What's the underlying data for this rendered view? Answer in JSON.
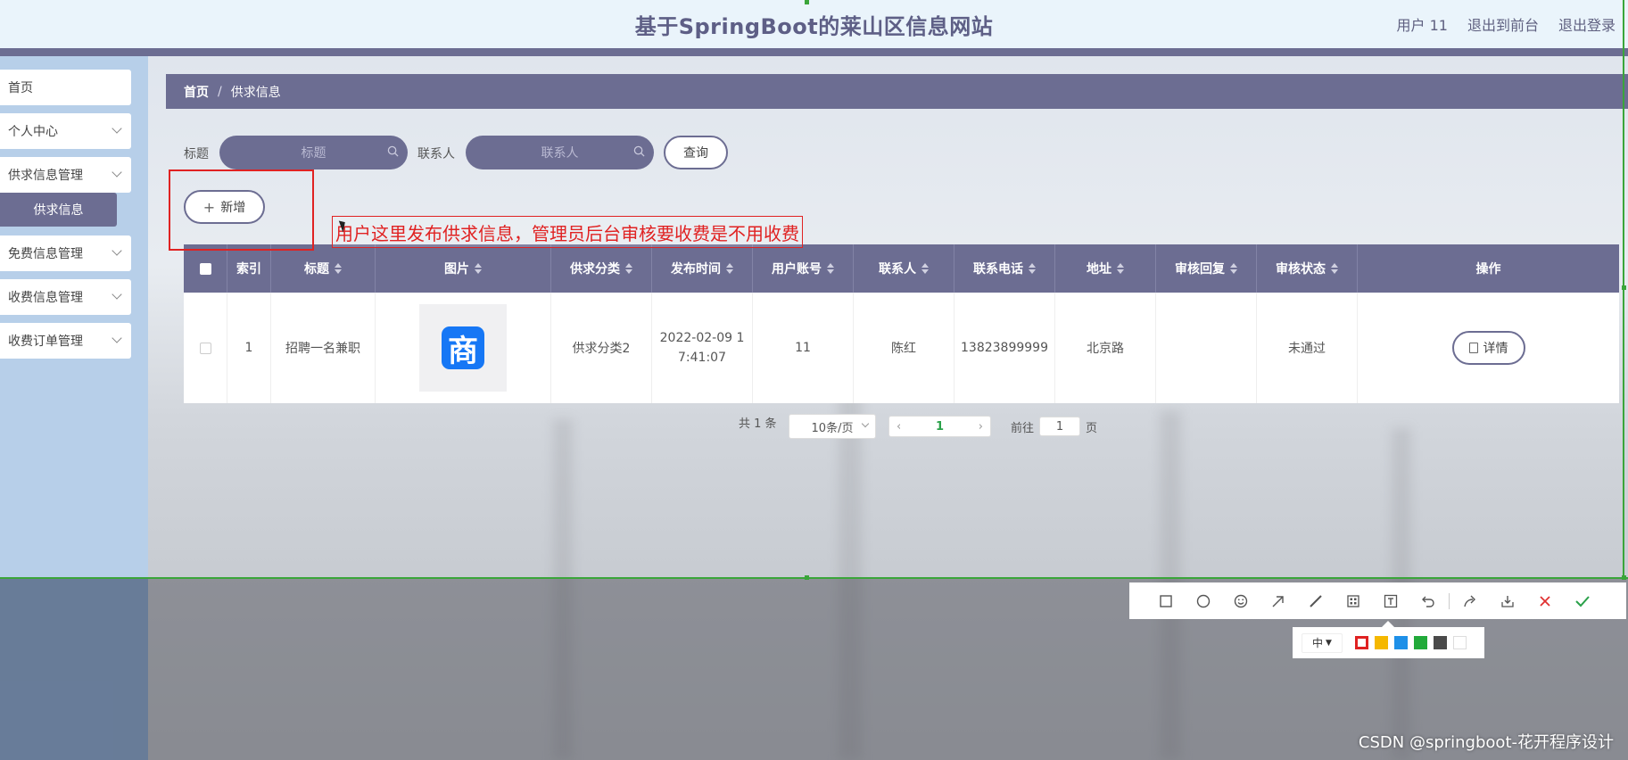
{
  "header": {
    "site_title": "基于SpringBoot的莱山区信息网站",
    "user_label": "用户 11",
    "frontend_link": "退出到前台",
    "logout_link": "退出登录"
  },
  "sidebar": {
    "items": [
      {
        "label": "首页"
      },
      {
        "label": "个人中心"
      },
      {
        "label": "供求信息管理"
      },
      {
        "label": "免费信息管理"
      },
      {
        "label": "收费信息管理"
      },
      {
        "label": "收费订单管理"
      }
    ],
    "active_submenu": "供求信息"
  },
  "breadcrumb": {
    "home": "首页",
    "separator": "/",
    "current": "供求信息"
  },
  "search": {
    "title_label": "标题",
    "title_placeholder": "标题",
    "contact_label": "联系人",
    "contact_placeholder": "联系人",
    "query_button": "查询"
  },
  "add_button": "新增",
  "annotation": "用户这里发布供求信息，管理员后台审核要收费是不用收费",
  "table": {
    "headers": [
      "索引",
      "标题",
      "图片",
      "供求分类",
      "发布时间",
      "用户账号",
      "联系人",
      "联系电话",
      "地址",
      "审核回复",
      "审核状态",
      "操作"
    ],
    "rows": [
      {
        "index": "1",
        "title": "招聘一名兼职",
        "image_icon": "商",
        "category": "供求分类2",
        "publish_time_line1": "2022-02-09 1",
        "publish_time_line2": "7:41:07",
        "account": "11",
        "contact": "陈红",
        "phone": "13823899999",
        "address": "北京路",
        "review_reply": "",
        "review_status": "未通过",
        "action_label": "详情"
      }
    ]
  },
  "pagination": {
    "total": "共 1 条",
    "page_size": "10条/页",
    "current_page": "1",
    "goto_label": "前往",
    "goto_value": "1",
    "page_suffix": "页"
  },
  "screenshot_tool": {
    "size_label": "中",
    "colors": [
      "#e02222",
      "#f5b800",
      "#1e90e8",
      "#22aa3a",
      "#4a4a4a",
      "#ffffff"
    ]
  },
  "watermark": "CSDN @springboot-花开程序设计"
}
